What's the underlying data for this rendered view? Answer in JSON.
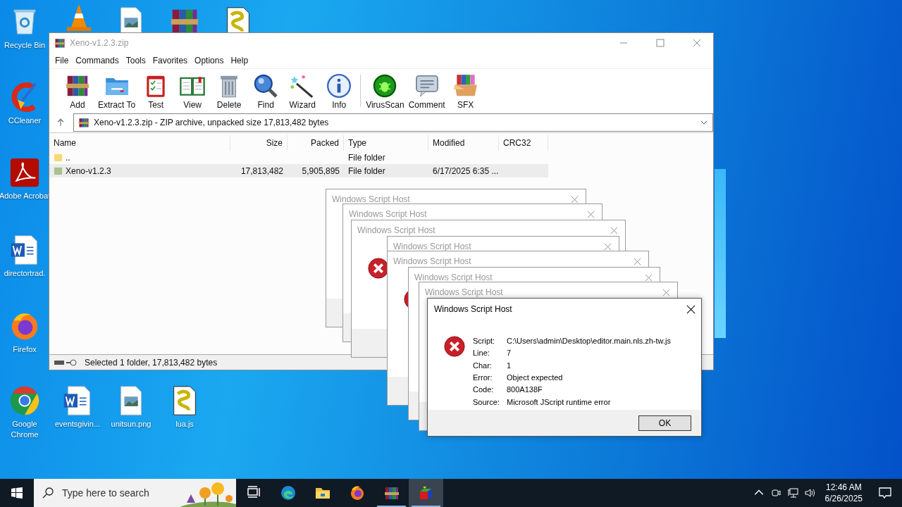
{
  "desktop_icons": [
    {
      "kind": "recycle",
      "label": "Recycle Bin"
    },
    {
      "kind": "vlc"
    },
    {
      "kind": "image"
    },
    {
      "kind": "winrar"
    },
    {
      "kind": "script"
    },
    {
      "kind": "ccleaner",
      "label": "CCleaner"
    },
    {
      "kind": "acrobat",
      "label": "Adobe Acrobat"
    },
    {
      "kind": "word",
      "label": "directortrad."
    },
    {
      "kind": "firefox",
      "label": "Firefox"
    },
    {
      "kind": "chrome",
      "label": "Google Chrome"
    },
    {
      "kind": "word",
      "label": "eventsgivin..."
    },
    {
      "kind": "image",
      "label": "unitsun.png"
    },
    {
      "kind": "script",
      "label": "lua.js"
    }
  ],
  "archive_window": {
    "title": "Xeno-v1.2.3.zip",
    "menu": [
      "File",
      "Commands",
      "Tools",
      "Favorites",
      "Options",
      "Help"
    ],
    "toolbar_groups": [
      [
        {
          "kind": "add",
          "label": "Add"
        },
        {
          "kind": "extract",
          "label": "Extract To"
        },
        {
          "kind": "test",
          "label": "Test"
        },
        {
          "kind": "view",
          "label": "View"
        },
        {
          "kind": "delete",
          "label": "Delete"
        },
        {
          "kind": "find",
          "label": "Find"
        },
        {
          "kind": "wizard",
          "label": "Wizard"
        },
        {
          "kind": "info",
          "label": "Info"
        }
      ],
      [
        {
          "kind": "virusscan",
          "label": "VirusScan"
        },
        {
          "kind": "comment",
          "label": "Comment"
        },
        {
          "kind": "sfx",
          "label": "SFX"
        }
      ]
    ],
    "address": "Xeno-v1.2.3.zip - ZIP archive, unpacked size 17,813,482 bytes",
    "columns": [
      "Name",
      "Size",
      "Packed",
      "Type",
      "Modified",
      "CRC32"
    ],
    "rows": [
      {
        "kind": "parent",
        "name": "..",
        "type": "File folder",
        "selected": false
      },
      {
        "kind": "folder",
        "name": "Xeno-v1.2.3",
        "size": "17,813,482",
        "packed": "5,905,895",
        "type": "File folder",
        "modified": "6/17/2025 6:35 ...",
        "selected": true
      }
    ],
    "status": "Selected 1 folder, 17,813,482 bytes"
  },
  "background_dialogs": [
    {
      "title": "Windows Script Host"
    },
    {
      "title": "Windows Script Host"
    },
    {
      "title": "Windows Script Host"
    },
    {
      "title": "Windows Script Host"
    },
    {
      "title": "Windows Script Host"
    },
    {
      "title": "Windows Script Host"
    },
    {
      "title": "Windows Script Host"
    }
  ],
  "error_dialog": {
    "title": "Windows Script Host",
    "fields": [
      {
        "label": "Script:",
        "value": "C:\\Users\\admin\\Desktop\\editor.main.nls.zh-tw.js"
      },
      {
        "label": "Line:",
        "value": "7"
      },
      {
        "label": "Char:",
        "value": "1"
      },
      {
        "label": "Error:",
        "value": "Object expected"
      },
      {
        "label": "Code:",
        "value": "800A138F"
      },
      {
        "label": "Source:",
        "value": "Microsoft JScript runtime error"
      }
    ],
    "button": "OK"
  },
  "taskbar": {
    "search_placeholder": "Type here to search",
    "apps": [
      {
        "kind": "taskview",
        "running": false,
        "active": false
      },
      {
        "kind": "edge",
        "running": false,
        "active": false
      },
      {
        "kind": "explorer",
        "running": false,
        "active": false
      },
      {
        "kind": "firefox",
        "running": false,
        "active": false
      },
      {
        "kind": "winrar",
        "running": true,
        "active": false
      },
      {
        "kind": "scripthost",
        "running": true,
        "active": true
      }
    ],
    "time": "12:46 AM",
    "date": "6/26/2025"
  }
}
